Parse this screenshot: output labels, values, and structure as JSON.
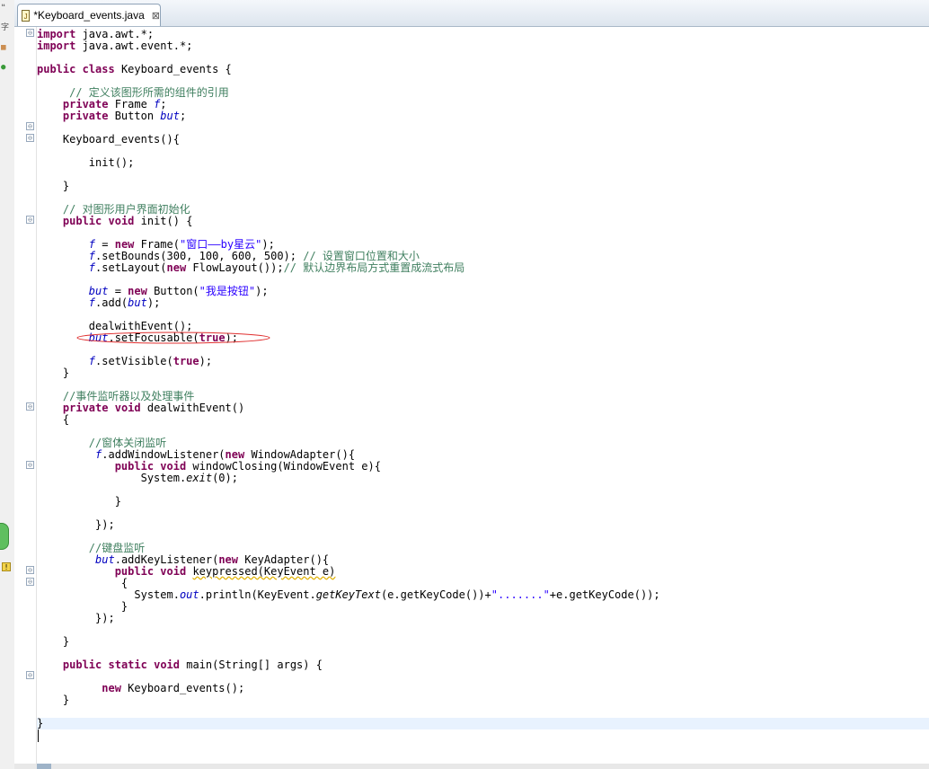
{
  "tab": {
    "title": "*Keyboard_events.java",
    "close": "⊠",
    "icon": "java-file-icon"
  },
  "gutter": {
    "fold_markers": [
      "⊖",
      "⊖",
      "⊖",
      "⊖",
      "⊖",
      "⊖",
      "⊖",
      "⊖",
      "⊖"
    ]
  },
  "code": {
    "lines": [
      [
        {
          "k": "kw",
          "t": "import"
        },
        {
          "t": " java.awt.*;"
        }
      ],
      [
        {
          "k": "kw",
          "t": "import"
        },
        {
          "t": " java.awt.event.*;"
        }
      ],
      [],
      [
        {
          "k": "kw",
          "t": "public"
        },
        {
          "t": " "
        },
        {
          "k": "kw",
          "t": "class"
        },
        {
          "t": " Keyboard_events {"
        }
      ],
      [],
      [
        {
          "t": "     "
        },
        {
          "k": "cm",
          "t": "// 定义该图形所需的组件的引用"
        }
      ],
      [
        {
          "t": "    "
        },
        {
          "k": "kw",
          "t": "private"
        },
        {
          "t": " Frame "
        },
        {
          "k": "fd",
          "t": "f"
        },
        {
          "t": ";"
        }
      ],
      [
        {
          "t": "    "
        },
        {
          "k": "kw",
          "t": "private"
        },
        {
          "t": " Button "
        },
        {
          "k": "fd",
          "t": "but"
        },
        {
          "t": ";"
        }
      ],
      [],
      [
        {
          "t": "    Keyboard_events(){"
        }
      ],
      [],
      [
        {
          "t": "        init();"
        }
      ],
      [],
      [
        {
          "t": "    }"
        }
      ],
      [],
      [
        {
          "t": "    "
        },
        {
          "k": "cm",
          "t": "// 对图形用户界面初始化"
        }
      ],
      [
        {
          "t": "    "
        },
        {
          "k": "kw",
          "t": "public"
        },
        {
          "t": " "
        },
        {
          "k": "kw",
          "t": "void"
        },
        {
          "t": " init() {"
        }
      ],
      [],
      [
        {
          "t": "        "
        },
        {
          "k": "fd",
          "t": "f"
        },
        {
          "t": " = "
        },
        {
          "k": "kw",
          "t": "new"
        },
        {
          "t": " Frame("
        },
        {
          "k": "st",
          "t": "\"窗口——by星云\""
        },
        {
          "t": ");"
        }
      ],
      [
        {
          "t": "        "
        },
        {
          "k": "fd",
          "t": "f"
        },
        {
          "t": ".setBounds(300, 100, 600, 500); "
        },
        {
          "k": "cm",
          "t": "// 设置窗口位置和大小"
        }
      ],
      [
        {
          "t": "        "
        },
        {
          "k": "fd",
          "t": "f"
        },
        {
          "t": ".setLayout("
        },
        {
          "k": "kw",
          "t": "new"
        },
        {
          "t": " FlowLayout());"
        },
        {
          "k": "cm",
          "t": "// 默认边界布局方式重置成流式布局"
        }
      ],
      [],
      [
        {
          "t": "        "
        },
        {
          "k": "fd",
          "t": "but"
        },
        {
          "t": " = "
        },
        {
          "k": "kw",
          "t": "new"
        },
        {
          "t": " Button("
        },
        {
          "k": "st",
          "t": "\"我是按钮\""
        },
        {
          "t": ");"
        }
      ],
      [
        {
          "t": "        "
        },
        {
          "k": "fd",
          "t": "f"
        },
        {
          "t": ".add("
        },
        {
          "k": "fd",
          "t": "but"
        },
        {
          "t": ");"
        }
      ],
      [],
      [
        {
          "t": "        dealwithEvent();"
        }
      ],
      [
        {
          "t": "        "
        },
        {
          "k": "fd",
          "t": "but"
        },
        {
          "t": ".setFocusable("
        },
        {
          "k": "kw",
          "t": "true"
        },
        {
          "t": ");"
        }
      ],
      [],
      [
        {
          "t": "        "
        },
        {
          "k": "fd",
          "t": "f"
        },
        {
          "t": ".setVisible("
        },
        {
          "k": "kw",
          "t": "true"
        },
        {
          "t": ");"
        }
      ],
      [
        {
          "t": "    }"
        }
      ],
      [],
      [
        {
          "t": "    "
        },
        {
          "k": "cm",
          "t": "//事件监听器以及处理事件"
        }
      ],
      [
        {
          "t": "    "
        },
        {
          "k": "kw",
          "t": "private"
        },
        {
          "t": " "
        },
        {
          "k": "kw",
          "t": "void"
        },
        {
          "t": " dealwithEvent()"
        }
      ],
      [
        {
          "t": "    {"
        }
      ],
      [],
      [
        {
          "t": "        "
        },
        {
          "k": "cm",
          "t": "//窗体关闭监听"
        }
      ],
      [
        {
          "t": "         "
        },
        {
          "k": "fd",
          "t": "f"
        },
        {
          "t": ".addWindowListener("
        },
        {
          "k": "kw",
          "t": "new"
        },
        {
          "t": " WindowAdapter(){"
        }
      ],
      [
        {
          "t": "            "
        },
        {
          "k": "kw",
          "t": "public"
        },
        {
          "t": " "
        },
        {
          "k": "kw",
          "t": "void"
        },
        {
          "t": " windowClosing(WindowEvent e){"
        }
      ],
      [
        {
          "t": "                System."
        },
        {
          "k": "it",
          "t": "exit"
        },
        {
          "t": "(0);"
        }
      ],
      [],
      [
        {
          "t": "            }"
        }
      ],
      [],
      [
        {
          "t": "         });"
        }
      ],
      [],
      [
        {
          "t": "        "
        },
        {
          "k": "cm",
          "t": "//键盘监听"
        }
      ],
      [
        {
          "t": "         "
        },
        {
          "k": "fd",
          "t": "but"
        },
        {
          "t": ".addKeyListener("
        },
        {
          "k": "kw",
          "t": "new"
        },
        {
          "t": " KeyAdapter(){"
        }
      ],
      [
        {
          "t": "            "
        },
        {
          "k": "kw",
          "t": "public"
        },
        {
          "t": " "
        },
        {
          "k": "kw",
          "t": "void"
        },
        {
          "t": " "
        },
        {
          "k": "wavy",
          "t": "keypressed(KeyEvent e)"
        }
      ],
      [
        {
          "t": "             {"
        }
      ],
      [
        {
          "t": "               System."
        },
        {
          "k": "fd",
          "t": "out"
        },
        {
          "t": ".println(KeyEvent."
        },
        {
          "k": "it",
          "t": "getKeyText"
        },
        {
          "t": "(e.getKeyCode())+"
        },
        {
          "k": "st",
          "t": "\".......\""
        },
        {
          "t": "+e.getKeyCode());"
        }
      ],
      [
        {
          "t": "             }"
        }
      ],
      [
        {
          "t": "         });"
        }
      ],
      [],
      [
        {
          "t": "    }"
        }
      ],
      [],
      [
        {
          "t": "    "
        },
        {
          "k": "kw",
          "t": "public"
        },
        {
          "t": " "
        },
        {
          "k": "kw",
          "t": "static"
        },
        {
          "t": " "
        },
        {
          "k": "kw",
          "t": "void"
        },
        {
          "t": " main(String[] args) {"
        }
      ],
      [],
      [
        {
          "t": "          "
        },
        {
          "k": "kw",
          "t": "new"
        },
        {
          "t": " Keyboard_events();"
        }
      ],
      [
        {
          "t": "    }"
        }
      ],
      [],
      [
        {
          "t": "}"
        }
      ]
    ],
    "current_line_index": 59
  },
  "annotation": {
    "shape": "ellipse",
    "color": "#e03030",
    "target": "but.setFocusable(true);"
  },
  "colors": {
    "keyword": "#7f0055",
    "comment": "#3f7f5f",
    "string": "#2a00ff",
    "field": "#0000c0",
    "current_line": "#e8f2fe"
  }
}
